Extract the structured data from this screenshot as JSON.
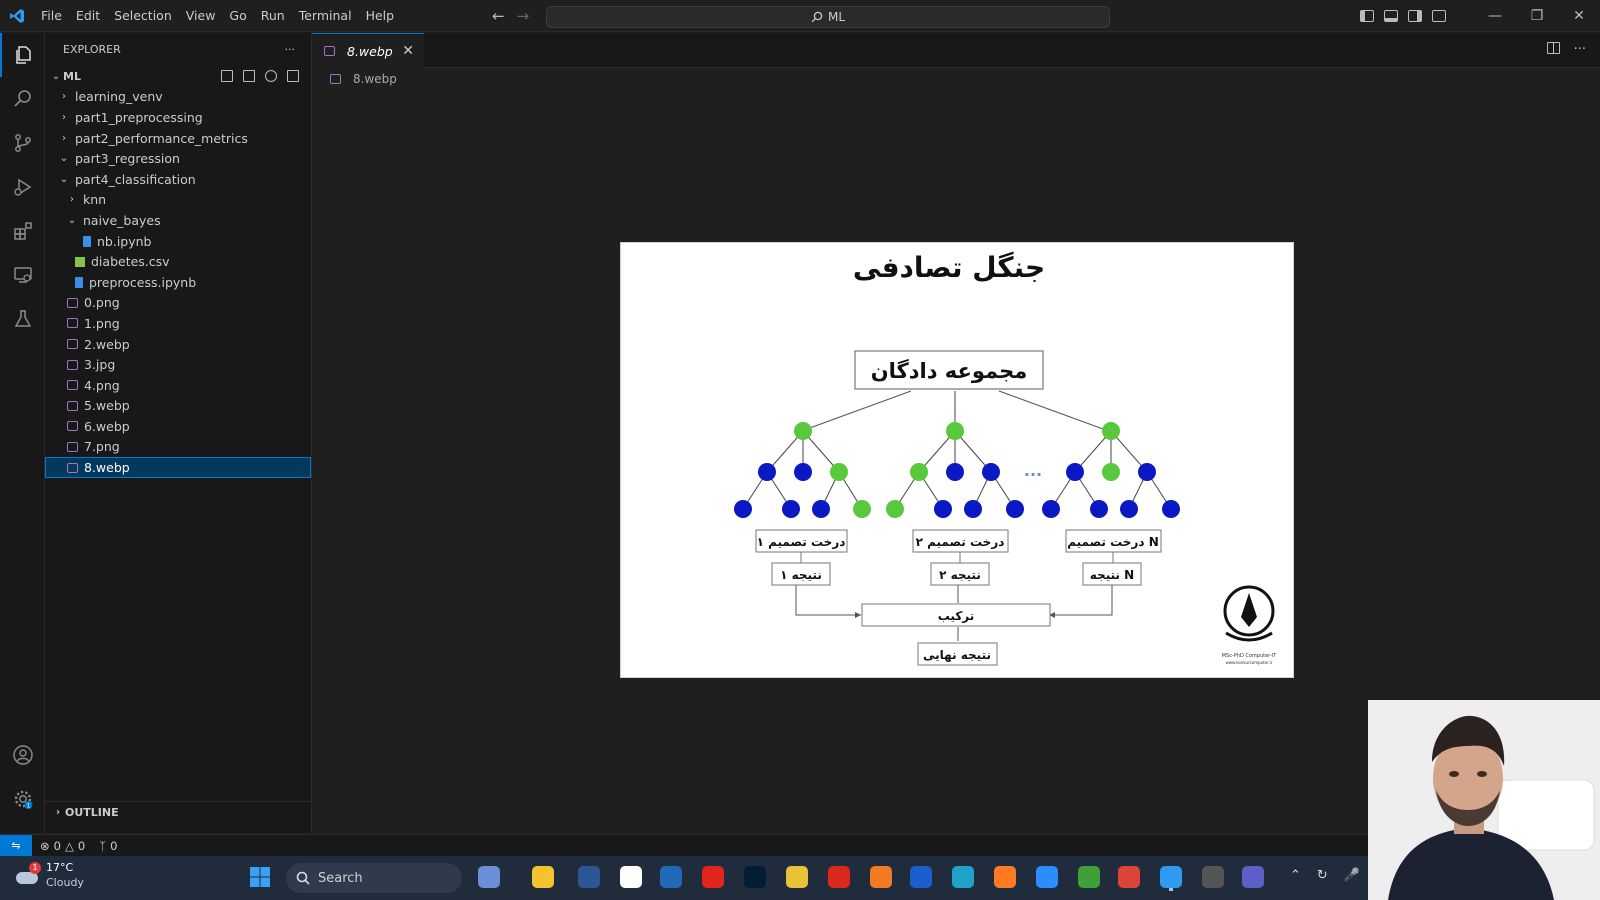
{
  "titlebar": {
    "menu": [
      "File",
      "Edit",
      "Selection",
      "View",
      "Go",
      "Run",
      "Terminal",
      "Help"
    ],
    "command_center": "ML",
    "nav_back": "←",
    "nav_forward": "→"
  },
  "sidebar": {
    "title": "EXPLORER",
    "more": "···",
    "root": "ML",
    "items": [
      {
        "label": "learning_venv",
        "type": "folder",
        "expanded": false,
        "depth": 1
      },
      {
        "label": "part1_preprocessing",
        "type": "folder",
        "expanded": false,
        "depth": 1
      },
      {
        "label": "part2_performance_metrics",
        "type": "folder",
        "expanded": false,
        "depth": 1
      },
      {
        "label": "part3_regression",
        "type": "folder",
        "expanded": true,
        "depth": 1
      },
      {
        "label": "part4_classification",
        "type": "folder",
        "expanded": true,
        "depth": 1
      },
      {
        "label": "knn",
        "type": "folder",
        "expanded": false,
        "depth": 2
      },
      {
        "label": "naive_bayes",
        "type": "folder",
        "expanded": true,
        "depth": 2
      },
      {
        "label": "nb.ipynb",
        "type": "notebook",
        "depth": 3
      },
      {
        "label": "diabetes.csv",
        "type": "csv",
        "depth": 2
      },
      {
        "label": "preprocess.ipynb",
        "type": "notebook",
        "depth": 2
      },
      {
        "label": "0.png",
        "type": "image",
        "depth": 1
      },
      {
        "label": "1.png",
        "type": "image",
        "depth": 1
      },
      {
        "label": "2.webp",
        "type": "image",
        "depth": 1
      },
      {
        "label": "3.jpg",
        "type": "image",
        "depth": 1
      },
      {
        "label": "4.png",
        "type": "image",
        "depth": 1
      },
      {
        "label": "5.webp",
        "type": "image",
        "depth": 1
      },
      {
        "label": "6.webp",
        "type": "image",
        "depth": 1
      },
      {
        "label": "7.png",
        "type": "image",
        "depth": 1
      },
      {
        "label": "8.webp",
        "type": "image",
        "depth": 1,
        "selected": true
      }
    ],
    "outline": "OUTLINE"
  },
  "editor": {
    "tab_label": "8.webp",
    "tab_close": "✕",
    "breadcrumb": "8.webp"
  },
  "slide": {
    "title": "جنگل تصادفی",
    "dataset": "مجموعه دادگان",
    "ellipsis": "...",
    "tree_labels": [
      "درخت تصمیم ۱",
      "درخت تصمیم ۲",
      "درخت تصمیم N"
    ],
    "result_labels": [
      "نتیجه ۱",
      "نتیجه ۲",
      "نتیجه N"
    ],
    "combine": "ترکیب",
    "final": "نتیجه نهایی",
    "logo_text_1": "MSc-PhD Computer-IT",
    "logo_text_2": "www.konkurcomputer.ir"
  },
  "statusbar": {
    "errors": "0",
    "warnings": "0",
    "ports": "0"
  },
  "taskbar": {
    "temperature": "17°C",
    "weather": "Cloudy",
    "weather_badge": "1",
    "search": "Search"
  },
  "colors": {
    "accent": "#0078d4",
    "node_green": "#5ac83c",
    "node_blue": "#0b19c4"
  }
}
